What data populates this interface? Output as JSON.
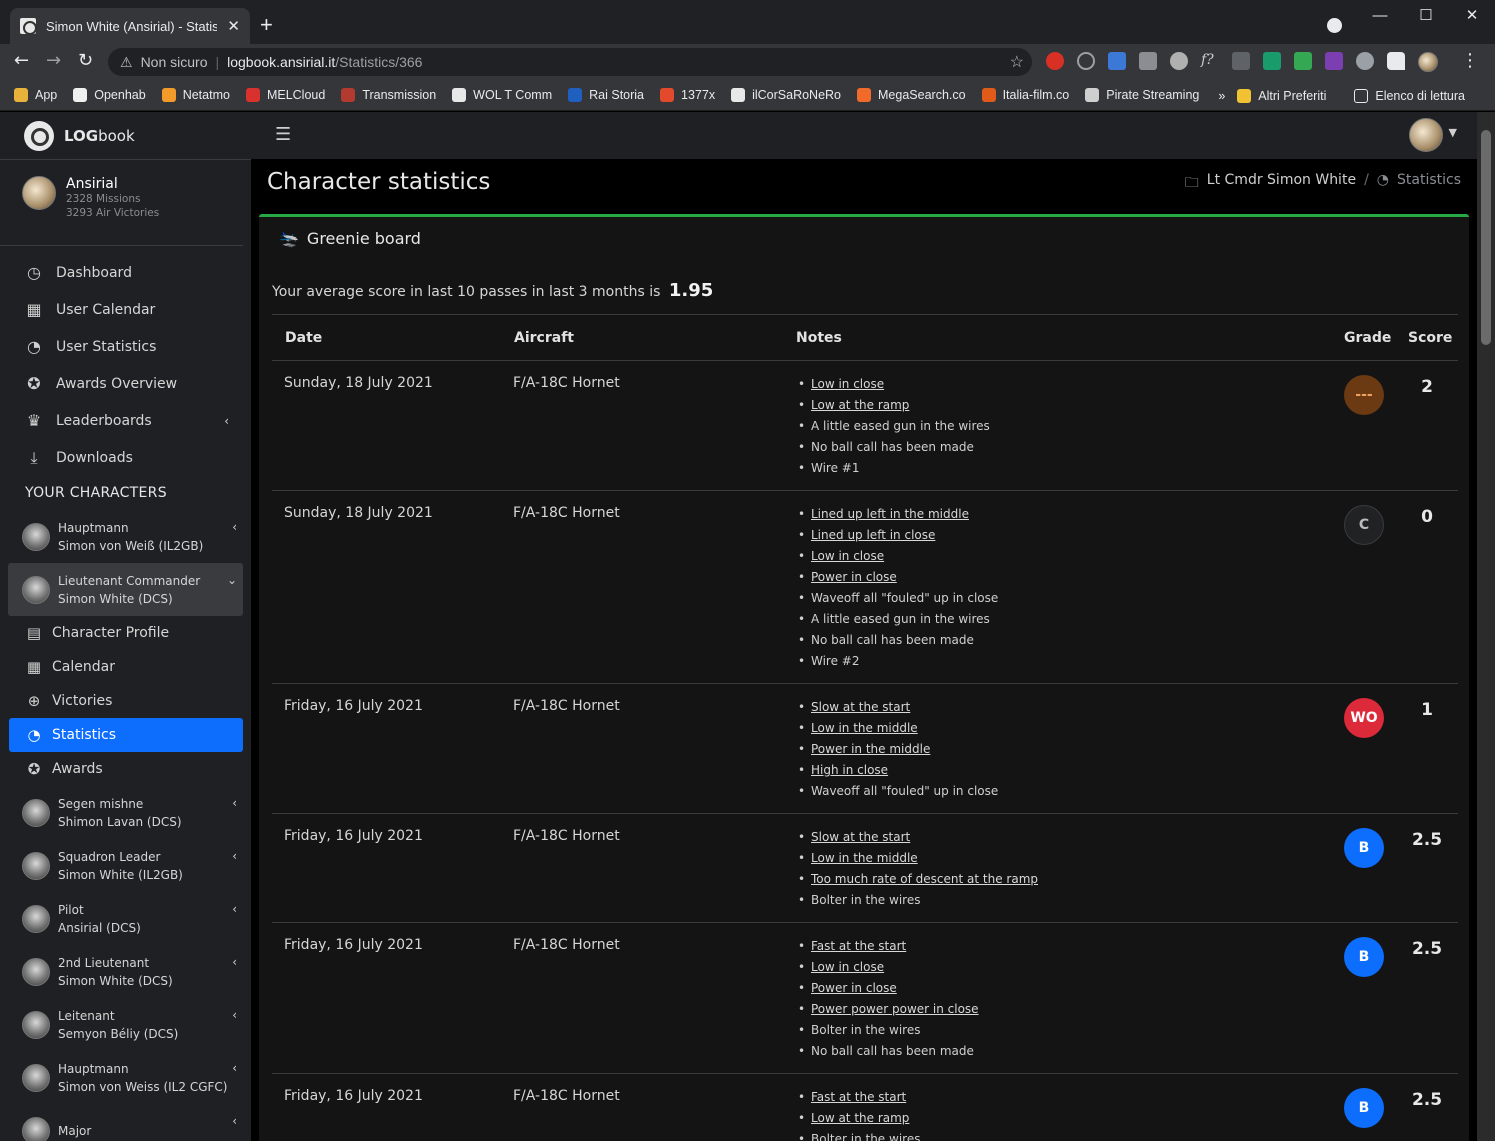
{
  "browser": {
    "tab_title": "Simon White (Ansirial) - Statistics",
    "tab_close": "✕",
    "new_tab": "+",
    "security_label": "Non sicuro",
    "url_host": "logbook.ansirial.it",
    "url_path": "/Statistics/366",
    "bookmarks": [
      {
        "label": "App",
        "color": "#e8b33a"
      },
      {
        "label": "Openhab",
        "color": "#f0f0f0"
      },
      {
        "label": "Netatmo",
        "color": "#f29b2b"
      },
      {
        "label": "MELCloud",
        "color": "#d9322e"
      },
      {
        "label": "Transmission",
        "color": "#b23a2e"
      },
      {
        "label": "WOL T Comm",
        "color": "#e8e8e8"
      },
      {
        "label": "Rai Storia",
        "color": "#1f5fbf"
      },
      {
        "label": "1377x",
        "color": "#e24a2b"
      },
      {
        "label": "ilCorSaRoNeRo",
        "color": "#e8e8e8"
      },
      {
        "label": "MegaSearch.co",
        "color": "#f06a2a"
      },
      {
        "label": "Italia-film.co",
        "color": "#e05b1a"
      },
      {
        "label": "Pirate Streaming",
        "color": "#cfcfcf"
      }
    ],
    "bookmarks_more": "»",
    "other_bookmarks": "Altri Preferiti",
    "reading_list": "Elenco di lettura"
  },
  "app": {
    "brand_strong": "LOG",
    "brand_rest": "book",
    "user": {
      "name": "Ansirial",
      "missions": "2328 Missions",
      "victories": "3293 Air Victories"
    },
    "nav": [
      {
        "label": "Dashboard",
        "icon": "tachometer-icon"
      },
      {
        "label": "User Calendar",
        "icon": "calendar-icon"
      },
      {
        "label": "User Statistics",
        "icon": "pie-chart-icon"
      },
      {
        "label": "Awards Overview",
        "icon": "medal-icon"
      },
      {
        "label": "Leaderboards",
        "icon": "trophy-icon"
      },
      {
        "label": "Downloads",
        "icon": "download-icon"
      }
    ],
    "characters_header": "YOUR CHARACTERS",
    "characters": [
      {
        "rank": "Hauptmann",
        "name": "Simon von Weiß (IL2GB)"
      },
      {
        "rank": "Lieutenant Commander",
        "name": "Simon White (DCS)"
      },
      {
        "rank": "Segen mishne",
        "name": "Shimon Lavan (DCS)"
      },
      {
        "rank": "Squadron Leader",
        "name": "Simon White (IL2GB)"
      },
      {
        "rank": "Pilot",
        "name": "Ansirial (DCS)"
      },
      {
        "rank": "2nd Lieutenant",
        "name": "Simon White (DCS)"
      },
      {
        "rank": "Leitenant",
        "name": "Semyon Béliy (DCS)"
      },
      {
        "rank": "Hauptmann",
        "name": "Simon von Weiss (IL2 CGFC)"
      },
      {
        "rank": "Major",
        "name": ""
      }
    ],
    "character_menu": [
      {
        "label": "Character Profile",
        "icon": "id-card-icon"
      },
      {
        "label": "Calendar",
        "icon": "calendar-icon"
      },
      {
        "label": "Victories",
        "icon": "crosshairs-icon"
      },
      {
        "label": "Statistics",
        "icon": "pie-chart-icon"
      },
      {
        "label": "Awards",
        "icon": "medal-icon"
      }
    ]
  },
  "page": {
    "title": "Character statistics",
    "breadcrumb": {
      "parent": "Lt Cmdr Simon White",
      "sep": "/",
      "current": "Statistics"
    },
    "card_title": "Greenie board",
    "avg_text": "Your average score in last 10 passes in last 3 months is",
    "avg_value": "1.95",
    "columns": {
      "date": "Date",
      "aircraft": "Aircraft",
      "notes": "Notes",
      "grade": "Grade",
      "score": "Score"
    },
    "rows": [
      {
        "date": "Sunday, 18 July 2021",
        "aircraft": "F/A-18C Hornet",
        "grade": "---",
        "grade_color": "#6b3a12",
        "score": "2",
        "notes": [
          [
            "Low in close",
            true
          ],
          [
            "Low at the ramp",
            true
          ],
          [
            "A little eased gun in the wires",
            false
          ],
          [
            "No ball call has been made",
            false
          ],
          [
            "Wire #1",
            false
          ]
        ]
      },
      {
        "date": "Sunday, 18 July 2021",
        "aircraft": "F/A-18C Hornet",
        "grade": "C",
        "grade_color": "#212224",
        "score": "0",
        "notes": [
          [
            "Lined up left in the middle",
            true
          ],
          [
            "Lined up left in close",
            true
          ],
          [
            "Low in close",
            true
          ],
          [
            "Power in close",
            true
          ],
          [
            "Waveoff all \"fouled\" up in close",
            false
          ],
          [
            "A little eased gun in the wires",
            false
          ],
          [
            "No ball call has been made",
            false
          ],
          [
            "Wire #2",
            false
          ]
        ]
      },
      {
        "date": "Friday, 16 July 2021",
        "aircraft": "F/A-18C Hornet",
        "grade": "WO",
        "grade_color": "#dc2a3a",
        "score": "1",
        "notes": [
          [
            "Slow at the start",
            true
          ],
          [
            "Low in the middle",
            true
          ],
          [
            "Power in the middle",
            true
          ],
          [
            "High in close",
            true
          ],
          [
            "Waveoff all \"fouled\" up in close",
            false
          ]
        ]
      },
      {
        "date": "Friday, 16 July 2021",
        "aircraft": "F/A-18C Hornet",
        "grade": "B",
        "grade_color": "#0d6efd",
        "score": "2.5",
        "notes": [
          [
            "Slow at the start",
            true
          ],
          [
            "Low in the middle",
            true
          ],
          [
            "Too much rate of descent at the ramp",
            true
          ],
          [
            "Bolter in the wires",
            false
          ]
        ]
      },
      {
        "date": "Friday, 16 July 2021",
        "aircraft": "F/A-18C Hornet",
        "grade": "B",
        "grade_color": "#0d6efd",
        "score": "2.5",
        "notes": [
          [
            "Fast at the start",
            true
          ],
          [
            "Low in close",
            true
          ],
          [
            "Power in close",
            true
          ],
          [
            "Power power power in close",
            true
          ],
          [
            "Bolter in the wires",
            false
          ],
          [
            "No ball call has been made",
            false
          ]
        ]
      },
      {
        "date": "Friday, 16 July 2021",
        "aircraft": "F/A-18C Hornet",
        "grade": "B",
        "grade_color": "#0d6efd",
        "score": "2.5",
        "notes": [
          [
            "Fast at the start",
            true
          ],
          [
            "Low at the ramp",
            true
          ],
          [
            "Bolter in the wires",
            false
          ]
        ]
      }
    ]
  }
}
